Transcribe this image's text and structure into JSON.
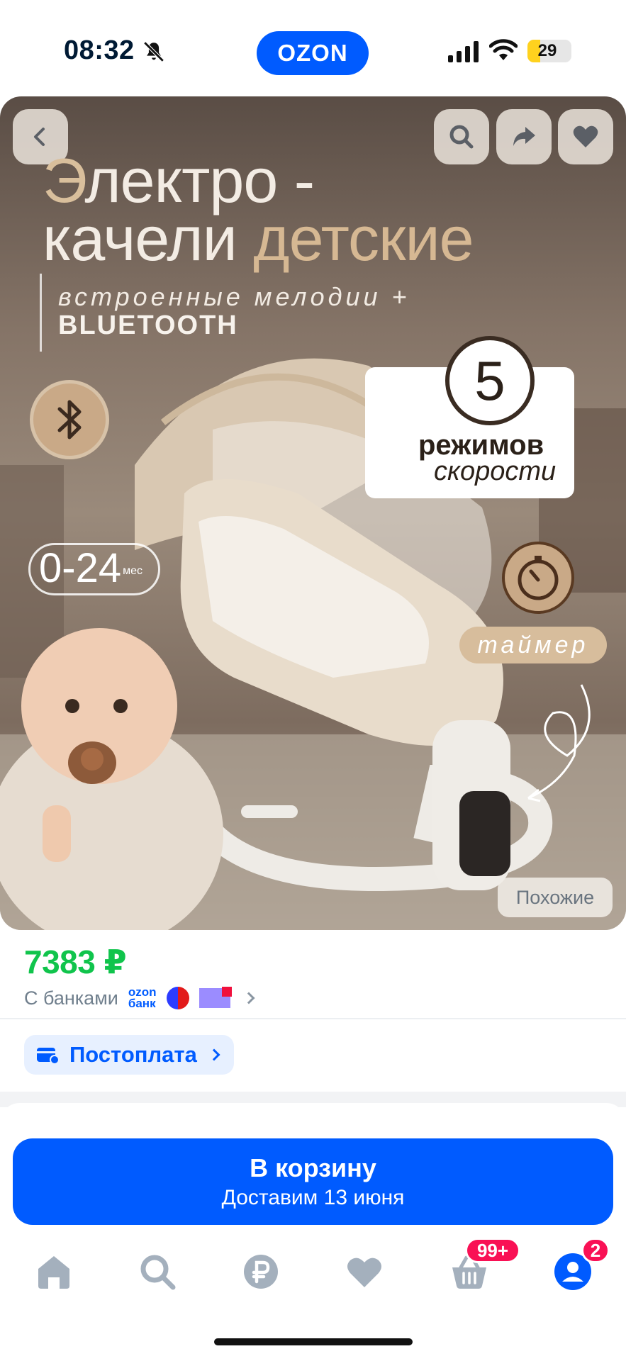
{
  "status_bar": {
    "time": "08:32",
    "battery": "29",
    "battery_level": 0.29
  },
  "header": {
    "logo": "OZON"
  },
  "hero": {
    "title_line1_first": "Э",
    "title_line1_rest": "лектро -",
    "title_line2_a": "качели ",
    "title_line2_b": "детские",
    "subtitle_1": "встроенные мелодии +",
    "subtitle_2": "BLUETOOTH",
    "speed_number": "5",
    "speed_line1": "режимов",
    "speed_line2": "скорости",
    "age_range": "0-24",
    "age_unit": "мес",
    "timer_label": "таймер",
    "similar_label": "Похожие"
  },
  "product": {
    "price": "7383 ₽",
    "banks_label": "С банками",
    "ozon_bank_line1": "ozon",
    "ozon_bank_line2": "банк",
    "postpay_label": "Постоплата"
  },
  "cart": {
    "title": "В корзину",
    "subtitle": "Доставим 13 июня"
  },
  "tabbar": {
    "cart_badge": "99+",
    "profile_badge": "2"
  },
  "colors": {
    "brand": "#005bff",
    "price": "#10c44c",
    "badge": "#f91155"
  }
}
